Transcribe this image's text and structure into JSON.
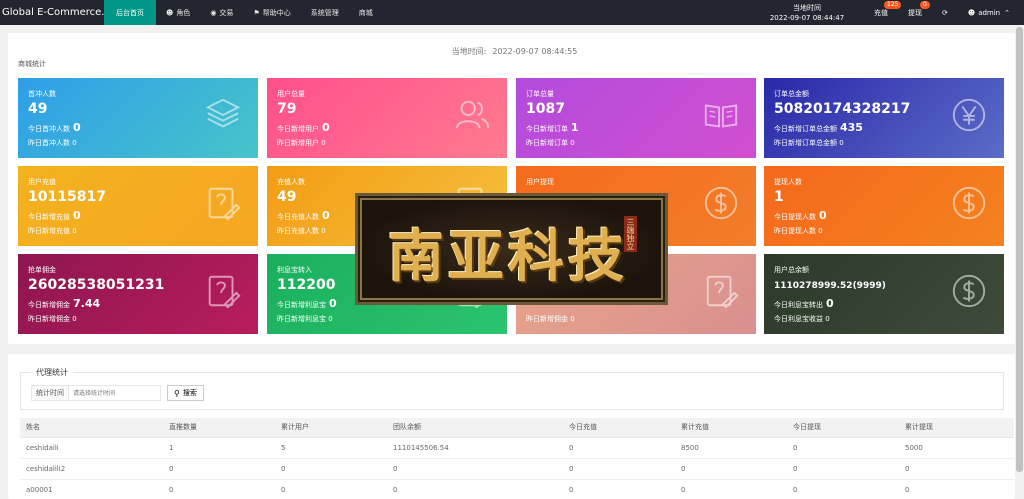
{
  "app": {
    "brand": "Global E-Commerce...",
    "nav": [
      {
        "label": "后台首页",
        "icon": ""
      },
      {
        "label": "角色",
        "icon": "user-icon"
      },
      {
        "label": "交易",
        "icon": "money-icon"
      },
      {
        "label": "帮助中心",
        "icon": "flag-icon"
      },
      {
        "label": "系统管理",
        "icon": ""
      },
      {
        "label": "商城",
        "icon": ""
      }
    ],
    "time_label": "当地时间",
    "time_value": "2022-09-07 08:44:47",
    "recharge_label": "充值",
    "recharge_badge": "125",
    "withdraw_label": "提现",
    "withdraw_badge": "0",
    "refresh_icon": "refresh-icon",
    "user": "admin"
  },
  "dashboard": {
    "current_time_label": "当地时间:",
    "current_time_value": "2022-09-07 08:44:55",
    "section_title": "商城统计",
    "cards": [
      {
        "title": "首冲人数",
        "value": "49",
        "today_label": "今日首冲人数",
        "today_value": "0",
        "yest": "昨日首冲人数 0",
        "icon": "layers-icon",
        "color": "#2f9ee8"
      },
      {
        "title": "用户总量",
        "value": "79",
        "today_label": "今日新增用户",
        "today_value": "0",
        "yest": "昨日新增用户 0",
        "icon": "users-icon",
        "color": "#ff4f8c"
      },
      {
        "title": "订单总量",
        "value": "1087",
        "today_label": "今日新增订单",
        "today_value": "1",
        "yest": "昨日新增订单 0",
        "icon": "book-icon",
        "color": "#b34bdc"
      },
      {
        "title": "订单总金额",
        "value": "50820174328217",
        "today_label": "今日新增订单总金额",
        "today_value": "435",
        "yest": "昨日新增订单总金额 0",
        "icon": "yen-icon",
        "color": "#2a28a8"
      },
      {
        "title": "用户充值",
        "value": "10115817",
        "today_label": "今日新增充值",
        "today_value": "0",
        "yest": "昨日新增充值 0",
        "icon": "edit-icon",
        "color": "#f3b21e"
      },
      {
        "title": "充值人数",
        "value": "49",
        "today_label": "今日充值人数",
        "today_value": "0",
        "yest": "昨日充值人数 0",
        "icon": "edit-icon",
        "color": "#f39c12"
      },
      {
        "title": "用户提现",
        "value": "",
        "today_label": "",
        "today_value": "",
        "yest": "",
        "icon": "dollar-icon",
        "color": "#f46b1c"
      },
      {
        "title": "提现人数",
        "value": "1",
        "today_label": "今日提现人数",
        "today_value": "0",
        "yest": "昨日提现人数 0",
        "icon": "dollar-icon",
        "color": "#f4681c"
      },
      {
        "title": "抢单佣金",
        "value": "26028538051231",
        "today_label": "今日新增佣金",
        "today_value": "7.44",
        "yest": "昨日新增佣金 0",
        "icon": "edit-icon",
        "color": "#8e1650"
      },
      {
        "title": "利息宝转入",
        "value": "112200",
        "today_label": "今日新增利息宝",
        "today_value": "0",
        "yest": "昨日新增利息宝 0",
        "icon": "edit-icon",
        "color": "#1aaf5d"
      },
      {
        "title": "",
        "value": "",
        "today_label": "",
        "today_value": "",
        "yest": "昨日新增佣金 0",
        "icon": "edit-icon",
        "color": "#e8a48a"
      },
      {
        "title": "用户总余额",
        "value": "1110278999.52(9999)",
        "today_label": "今日利息宝转出",
        "today_value": "0",
        "yest": "今日利息宝收益 0",
        "icon": "dollar-icon",
        "color": "#2b3a2a"
      }
    ],
    "logo_text": "南亚科技",
    "logo_sub": "三端独立"
  },
  "agent": {
    "legend": "代理统计",
    "search_label": "统计时间",
    "search_placeholder": "请选择统计时间",
    "search_button": "搜索",
    "columns": [
      "姓名",
      "直推数量",
      "累计用户",
      "团队余额",
      "今日充值",
      "累计充值",
      "今日提现",
      "累计提现"
    ],
    "rows": [
      [
        "ceshidaili",
        "1",
        "5",
        "1110145506.54",
        "0",
        "8500",
        "0",
        "5000"
      ],
      [
        "ceshidalili2",
        "0",
        "0",
        "0",
        "0",
        "0",
        "0",
        "0"
      ],
      [
        "a00001",
        "0",
        "0",
        "0",
        "0",
        "0",
        "0",
        "0"
      ]
    ]
  }
}
